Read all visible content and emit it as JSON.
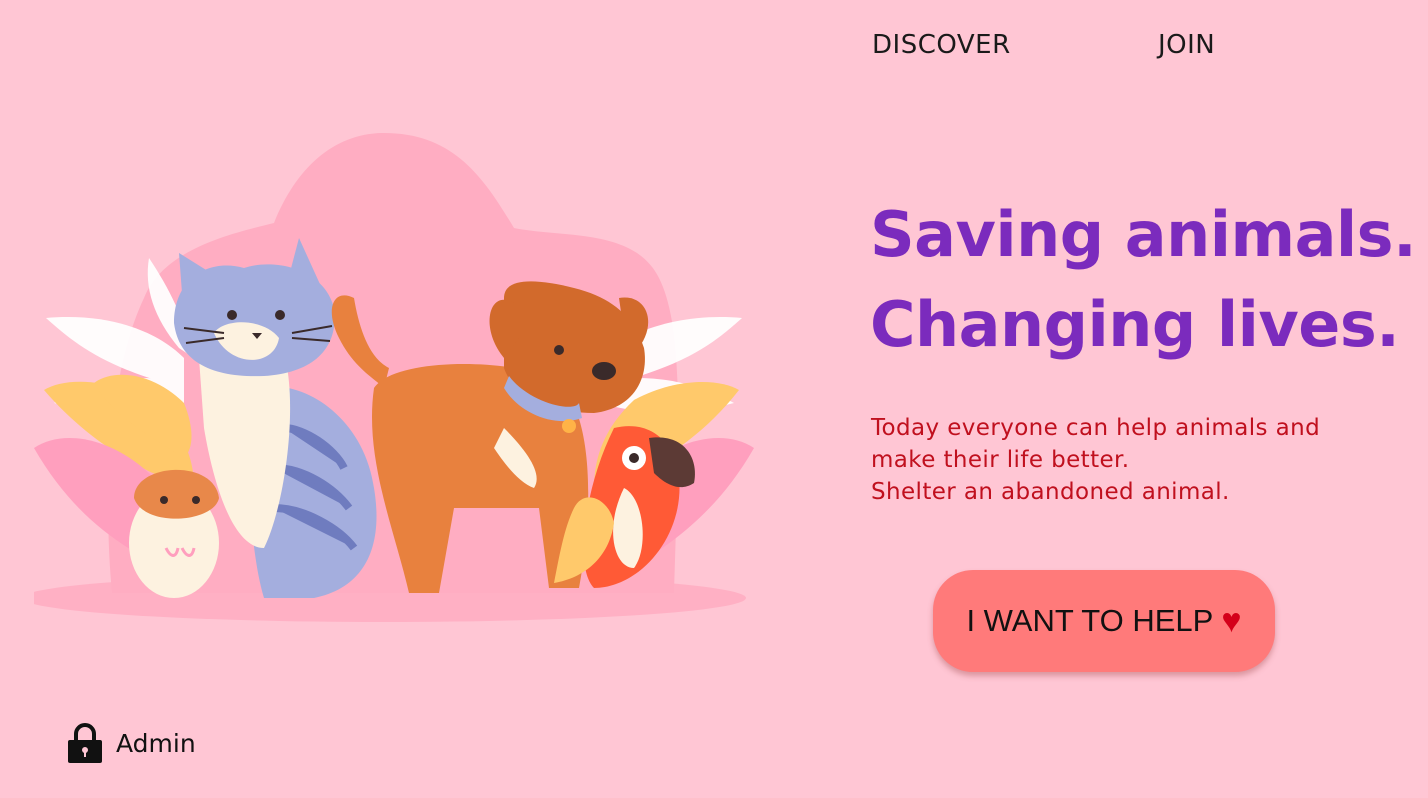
{
  "nav": {
    "discover_label": "DISCOVER",
    "join_label": "JOIN"
  },
  "hero": {
    "headline_line1": "Saving animals.",
    "headline_line2": "Changing lives.",
    "text_line1": "Today everyone can help animals and",
    "text_line2": "make their life better.",
    "text_line3": "Shelter an abandoned animal.",
    "cta_label": "I WANT TO HELP",
    "cta_icon": "heart-icon"
  },
  "admin": {
    "label": "Admin",
    "icon": "lock-icon"
  },
  "illustration": {
    "animals": [
      "cat",
      "dog",
      "hamster",
      "parrot"
    ]
  },
  "colors": {
    "background": "#ffc6d4",
    "headline": "#7b2bbd",
    "body_text": "#c0101e",
    "button": "#ff7a7a",
    "heart": "#d4001a"
  }
}
